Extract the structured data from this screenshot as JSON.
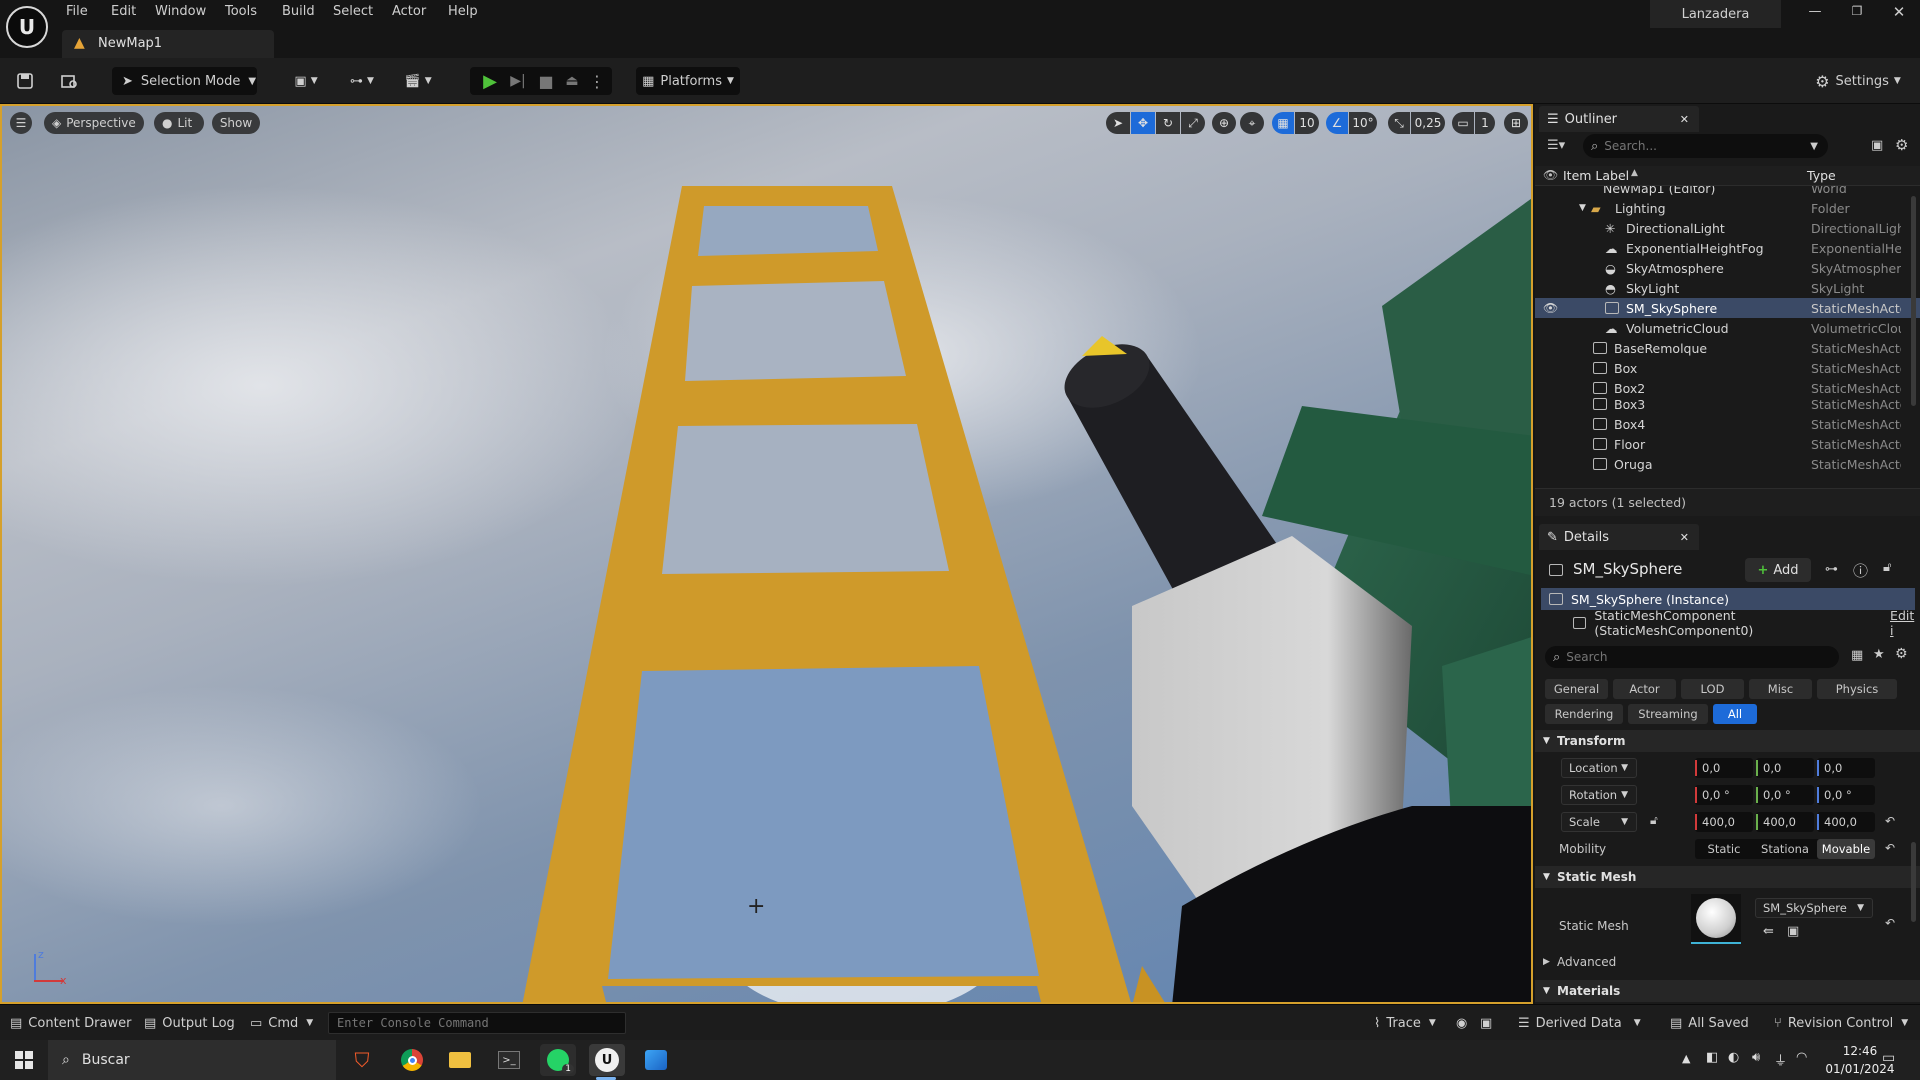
{
  "window": {
    "project": "Lanzadera",
    "map_tab": "NewMap1"
  },
  "menu": [
    "File",
    "Edit",
    "Window",
    "Tools",
    "Build",
    "Select",
    "Actor",
    "Help"
  ],
  "toolbar": {
    "selection_mode": "Selection Mode",
    "platforms": "Platforms",
    "settings": "Settings"
  },
  "viewport": {
    "perspective": "Perspective",
    "lit": "Lit",
    "show": "Show",
    "grid_snap": "10",
    "rotation_snap": "10°",
    "scale_snap": "0,25",
    "camera_speed": "1",
    "axis_z": "z",
    "axis_x": "x"
  },
  "outliner": {
    "title": "Outliner",
    "search_placeholder": "Search...",
    "col_label": "Item Label",
    "col_type": "Type",
    "rows": [
      {
        "label": "NewMap1 (Editor)",
        "type": "World"
      },
      {
        "label": "Lighting",
        "type": "Folder"
      },
      {
        "label": "DirectionalLight",
        "type": "DirectionalLight"
      },
      {
        "label": "ExponentialHeightFog",
        "type": "ExponentialHeig"
      },
      {
        "label": "SkyAtmosphere",
        "type": "SkyAtmosphere"
      },
      {
        "label": "SkyLight",
        "type": "SkyLight"
      },
      {
        "label": "SM_SkySphere",
        "type": "StaticMeshActo"
      },
      {
        "label": "VolumetricCloud",
        "type": "VolumetricClou"
      },
      {
        "label": "BaseRemolque",
        "type": "StaticMeshActo"
      },
      {
        "label": "Box",
        "type": "StaticMeshActo"
      },
      {
        "label": "Box2",
        "type": "StaticMeshActo"
      },
      {
        "label": "Box3",
        "type": "StaticMeshActo"
      },
      {
        "label": "Box4",
        "type": "StaticMeshActo"
      },
      {
        "label": "Floor",
        "type": "StaticMeshActo"
      },
      {
        "label": "Oruga",
        "type": "StaticMeshActo"
      }
    ],
    "footer": "19 actors (1 selected)"
  },
  "details": {
    "title": "Details",
    "actor_name": "SM_SkySphere",
    "add_label": "Add",
    "instance": "SM_SkySphere (Instance)",
    "component": "StaticMeshComponent (StaticMeshComponent0)",
    "edit_link": "Edit i",
    "search_placeholder": "Search",
    "categories": [
      "General",
      "Actor",
      "LOD",
      "Misc",
      "Physics",
      "Rendering",
      "Streaming",
      "All"
    ],
    "transform_header": "Transform",
    "location_label": "Location",
    "location": [
      "0,0",
      "0,0",
      "0,0"
    ],
    "rotation_label": "Rotation",
    "rotation": [
      "0,0 °",
      "0,0 °",
      "0,0 °"
    ],
    "scale_label": "Scale",
    "scale": [
      "400,0",
      "400,0",
      "400,0"
    ],
    "mobility_label": "Mobility",
    "mobility_options": [
      "Static",
      "Stationa",
      "Movable"
    ],
    "static_mesh_header": "Static Mesh",
    "static_mesh_label": "Static Mesh",
    "static_mesh_value": "SM_SkySphere",
    "advanced": "Advanced",
    "materials_header": "Materials"
  },
  "statusbar": {
    "content_drawer": "Content Drawer",
    "output_log": "Output Log",
    "cmd": "Cmd",
    "console_placeholder": "Enter Console Command",
    "trace": "Trace",
    "derived_data": "Derived Data",
    "all_saved": "All Saved",
    "revision_control": "Revision Control"
  },
  "taskbar": {
    "search": "Buscar",
    "time": "12:46",
    "date": "01/01/2024",
    "whatsapp_badge": "1"
  }
}
